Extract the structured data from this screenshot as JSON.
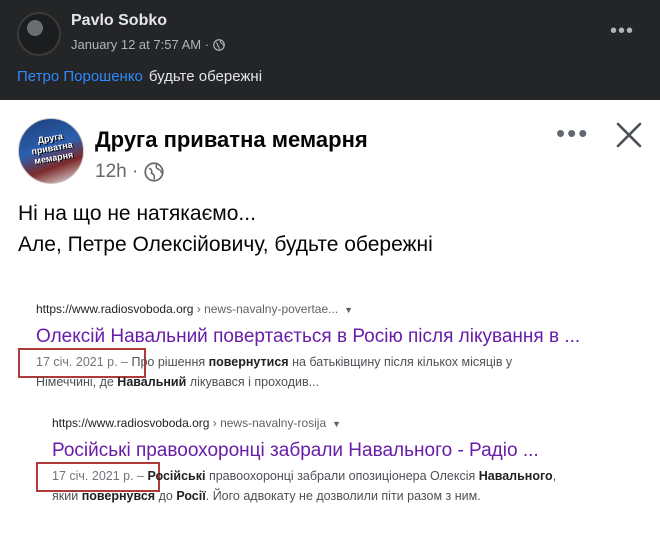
{
  "post": {
    "author": "Pavlo Sobko",
    "timestamp": "January 12 at 7:57 AM · ",
    "mention": "Петро Порошенко",
    "text": "будьте обережні"
  },
  "shared": {
    "page_name": "Друга приватна мемарня",
    "time": "12h · ",
    "avatar_text": "Друга приватна мемарня",
    "line1": "Ні на що не натякаємо...",
    "line2": "Але, Петре Олексійовичу, будьте обережні"
  },
  "results": [
    {
      "domain": "https://www.radiosvoboda.org",
      "path": " › news-navalny-povertae...",
      "caret": "▼",
      "title": "Олексій Навальний повертається в Росію після лікування в ...",
      "date": "17 січ. 2021 р. –",
      "snippet1_a": " Про рішення ",
      "snippet1_b": "повернутися",
      "snippet1_c": " на батьківщину після кількох місяців у",
      "snippet2_a": "Німеччині, де ",
      "snippet2_b": "Навальний",
      "snippet2_c": " лікувався і проходив..."
    },
    {
      "domain": "https://www.radiosvoboda.org",
      "path": " › news-navalny-rosija",
      "caret": "▼",
      "title": "Російські правоохоронці забрали Навального - Радіо ...",
      "date": "17 січ. 2021 р. –",
      "snippet1_a": " ",
      "snippet1_b": "Російські",
      "snippet1_c": " правоохоронці забрали опозиціонера Олексія ",
      "snippet1_d": "Навального",
      "snippet1_e": ",",
      "snippet2_a": "який ",
      "snippet2_b": "повернувся",
      "snippet2_c": " до ",
      "snippet2_d": "Росії",
      "snippet2_e": ". Його адвокату не дозволили піти разом з ним."
    }
  ],
  "colors": {
    "mention": "#2e89ff",
    "visited_link": "#681da8",
    "highlight_box": "#b03a3a"
  }
}
